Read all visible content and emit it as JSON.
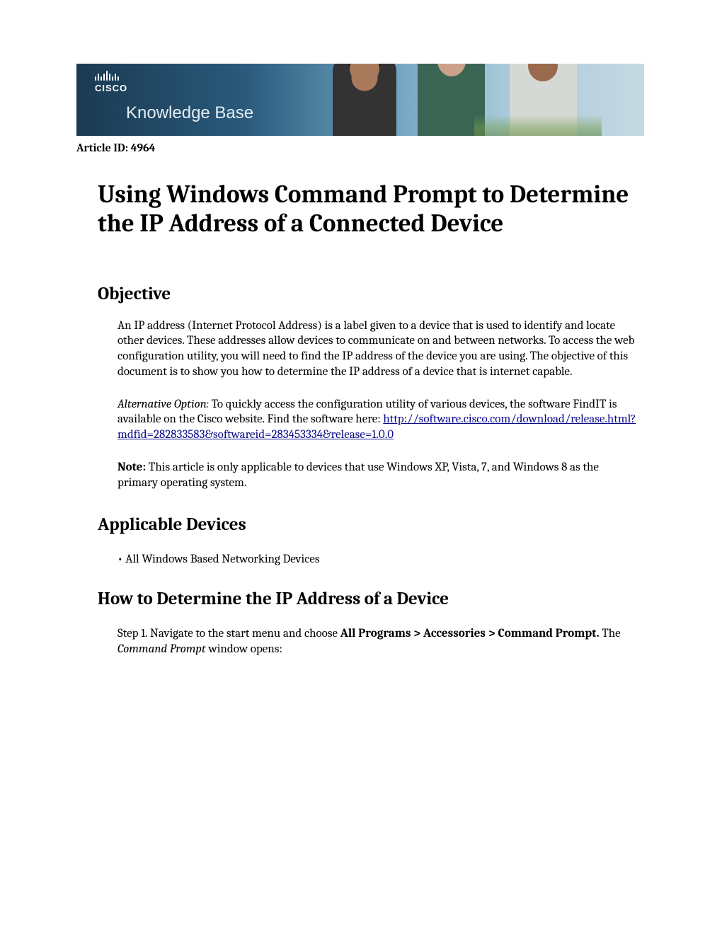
{
  "banner": {
    "brand_word": "CISCO",
    "kb_label": "Knowledge Base"
  },
  "article_id_label": "Article ID: 4964",
  "title": "Using Windows Command Prompt to Determine the IP Address of a Connected Device",
  "sections": {
    "objective": {
      "heading": "Objective",
      "p1": "An IP address (Internet Protocol Address) is a label given to a device that is used to identify and locate other devices. These addresses allow devices to communicate on and between networks. To access the web configuration utility, you will need to find the IP address of the device you are using. The objective of this document is to show you how to determine the IP address of a device that is internet capable.",
      "alt_prefix_italic": "Alternative Option:",
      "alt_text_before_link": "  To quickly access the configuration utility of various devices, the software FindIT is available on the Cisco website. Find the software here: ",
      "alt_link": "http://software.cisco.com/download/release.html?mdfid=282833583&softwareid=283453334&release=1.0.0",
      "note_label": "Note:",
      "note_text": " This article is only applicable to devices that use Windows XP, Vista, 7, and Windows 8 as the primary operating system."
    },
    "applicable": {
      "heading": "Applicable Devices",
      "bullet1": "• All Windows Based Networking Devices"
    },
    "howto": {
      "heading": "How to Determine the IP Address of a Device",
      "step1_lead": "Step 1. Navigate to the start menu and choose ",
      "step1_bold": "All Programs > Accessories > Command Prompt.",
      "step1_after1": " The ",
      "step1_italic": "Command Prompt",
      "step1_after2": " window opens:"
    }
  }
}
